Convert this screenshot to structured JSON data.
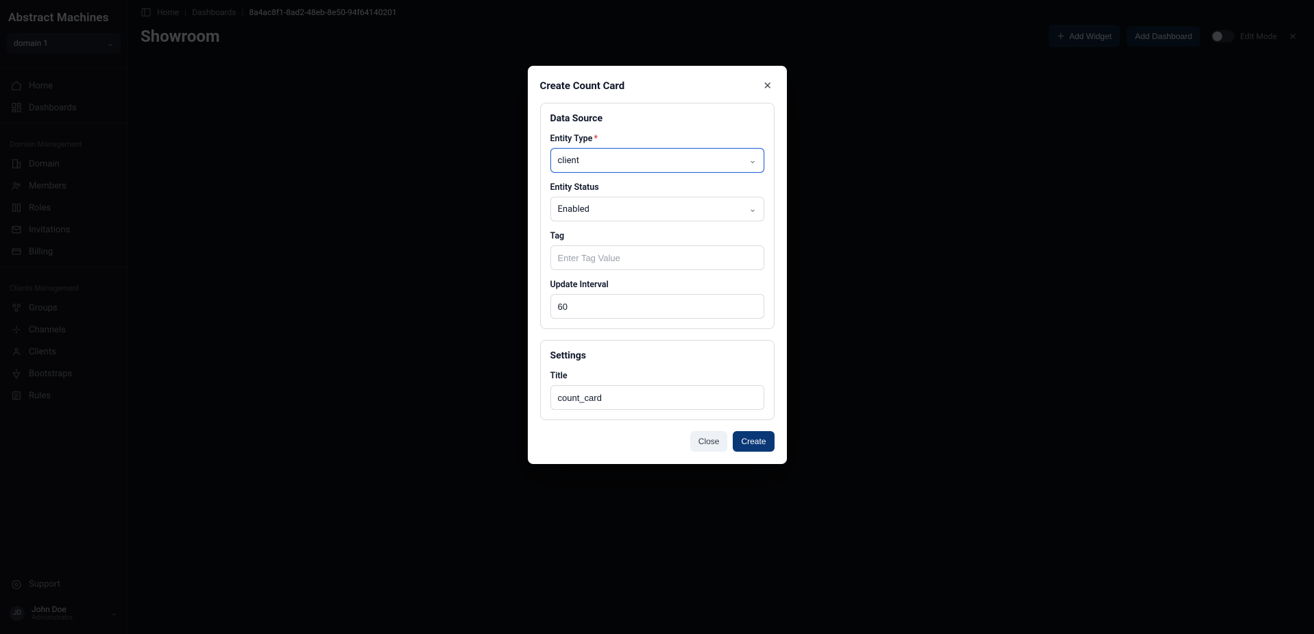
{
  "brand": "Abstract Machines",
  "domain_selector": {
    "label": "domain 1"
  },
  "nav_primary": [
    {
      "label": "Home",
      "icon": "home"
    },
    {
      "label": "Dashboards",
      "icon": "dashboard"
    }
  ],
  "sections": [
    {
      "title": "Domain Management",
      "items": [
        {
          "label": "Domain",
          "icon": "domain"
        },
        {
          "label": "Members",
          "icon": "members"
        },
        {
          "label": "Roles",
          "icon": "roles"
        },
        {
          "label": "Invitations",
          "icon": "mail"
        },
        {
          "label": "Billing",
          "icon": "card"
        }
      ]
    },
    {
      "title": "Clients Management",
      "items": [
        {
          "label": "Groups",
          "icon": "groups"
        },
        {
          "label": "Channels",
          "icon": "channels"
        },
        {
          "label": "Clients",
          "icon": "clients"
        },
        {
          "label": "Bootstraps",
          "icon": "bootstrap"
        },
        {
          "label": "Rules",
          "icon": "rules"
        }
      ]
    }
  ],
  "support_label": "Support",
  "user": {
    "name": "John Doe",
    "role": "Administrator"
  },
  "breadcrumbs": {
    "home": "Home",
    "section": "Dashboards",
    "current": "8a4ac8f1-8ad2-48eb-8e50-94f64140201"
  },
  "page_title": "Showroom",
  "header": {
    "add_widget": "Add Widget",
    "add_dashboard": "Add Dashboard",
    "edit_mode": "Edit Mode"
  },
  "modal": {
    "title": "Create Count Card",
    "data_source": {
      "section_title": "Data Source",
      "entity_type_label": "Entity Type",
      "entity_type_value": "client",
      "entity_status_label": "Entity Status",
      "entity_status_value": "Enabled",
      "tag_label": "Tag",
      "tag_placeholder": "Enter Tag Value",
      "update_interval_label": "Update Interval",
      "update_interval_value": "60"
    },
    "settings": {
      "section_title": "Settings",
      "title_label": "Title",
      "title_value": "count_card"
    },
    "actions": {
      "close": "Close",
      "create": "Create"
    }
  }
}
